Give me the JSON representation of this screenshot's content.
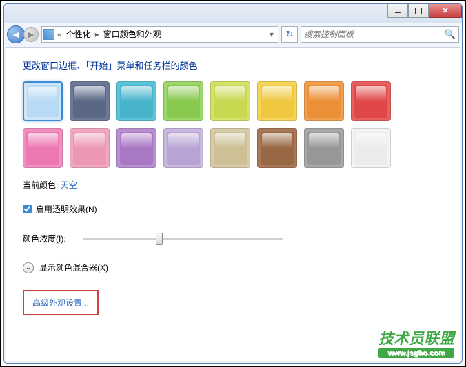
{
  "breadcrumb": {
    "prefix": "«",
    "item1": "个性化",
    "item2": "窗口颜色和外观"
  },
  "search": {
    "placeholder": "搜索控制面板"
  },
  "page": {
    "title": "更改窗口边框、「开始」菜单和任务栏的颜色"
  },
  "swatches": [
    {
      "name": "sky",
      "bg": "#cfe6f8",
      "inner": "#b8dbf5",
      "selected": true
    },
    {
      "name": "twilight",
      "bg": "#6d7998",
      "inner": "#5a6885",
      "selected": false
    },
    {
      "name": "sea",
      "bg": "#5dc3d8",
      "inner": "#48b4cc",
      "selected": false
    },
    {
      "name": "leaf",
      "bg": "#9dd66a",
      "inner": "#88ca50",
      "selected": false
    },
    {
      "name": "lime",
      "bg": "#d4e26a",
      "inner": "#c8d850",
      "selected": false
    },
    {
      "name": "sun",
      "bg": "#f5d45a",
      "inner": "#f0c840",
      "selected": false
    },
    {
      "name": "pumpkin",
      "bg": "#f2a050",
      "inner": "#ec9038",
      "selected": false
    },
    {
      "name": "ruby",
      "bg": "#e86060",
      "inner": "#e04848",
      "selected": false
    },
    {
      "name": "fuchsia",
      "bg": "#f090c0",
      "inner": "#ec78b0",
      "selected": false
    },
    {
      "name": "blush",
      "bg": "#f0a8c0",
      "inner": "#ec98b4",
      "selected": false
    },
    {
      "name": "violet",
      "bg": "#b890d0",
      "inner": "#a878c4",
      "selected": false
    },
    {
      "name": "lavender",
      "bg": "#c8b8e0",
      "inner": "#b8a4d4",
      "selected": false
    },
    {
      "name": "taupe",
      "bg": "#d8cca8",
      "inner": "#ccc094",
      "selected": false
    },
    {
      "name": "chocolate",
      "bg": "#a87858",
      "inner": "#986844",
      "selected": false
    },
    {
      "name": "slate",
      "bg": "#a8a8a8",
      "inner": "#989898",
      "selected": false
    },
    {
      "name": "frost",
      "bg": "#f4f4f4",
      "inner": "#ececec",
      "selected": false
    }
  ],
  "current": {
    "label": "当前颜色:",
    "value": "天空"
  },
  "transparency": {
    "label": "启用透明效果(N)",
    "checked": true
  },
  "intensity": {
    "label": "颜色浓度(I):",
    "percent": 38
  },
  "mixer": {
    "label": "显示颜色混合器(X)"
  },
  "advanced": {
    "link": "高级外观设置..."
  },
  "watermark": {
    "text": "技术员联盟",
    "url": "www.jsgho.com"
  }
}
